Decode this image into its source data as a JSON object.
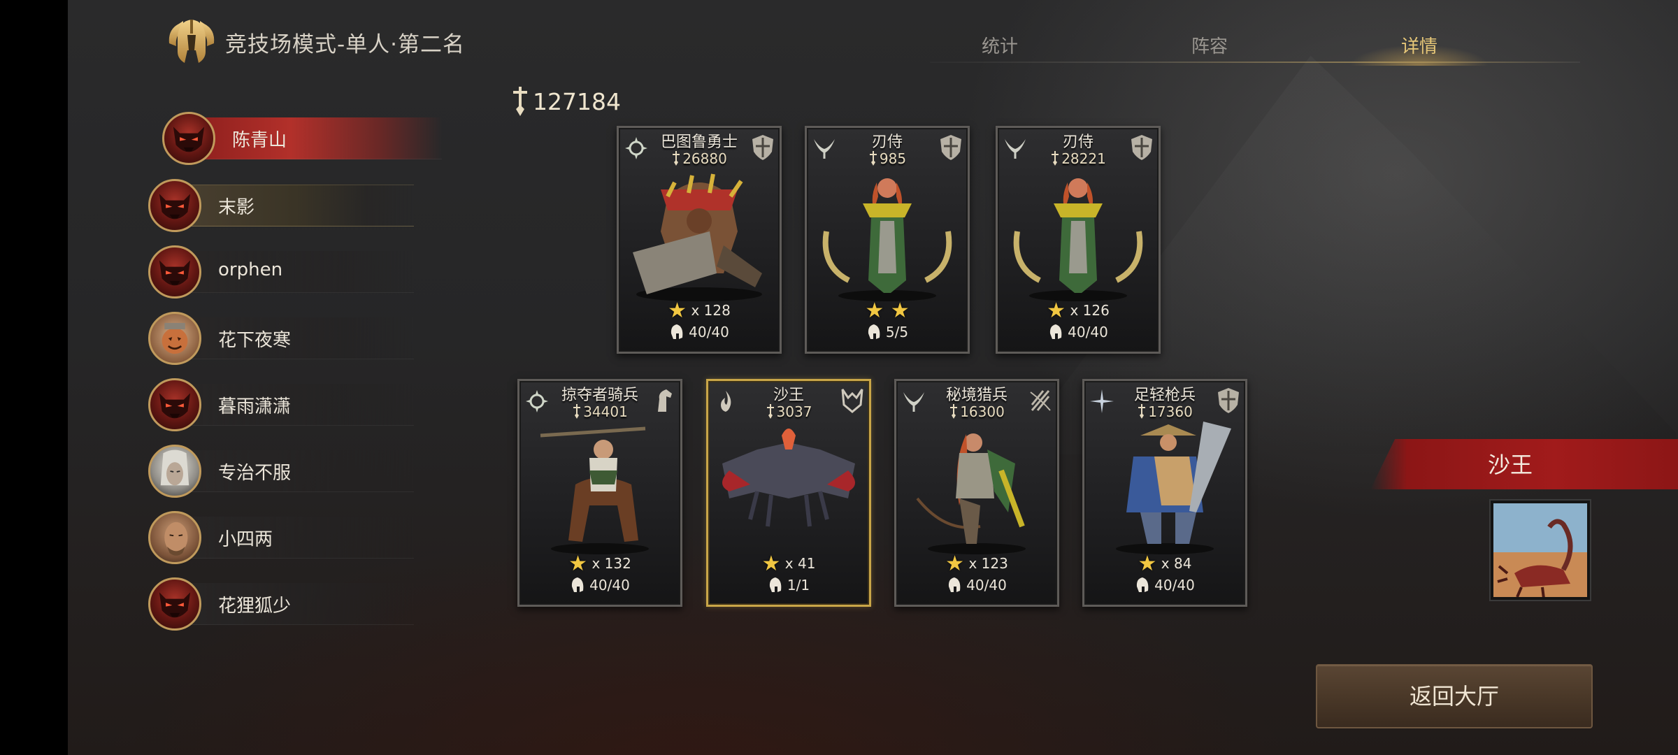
{
  "header": {
    "title": "竞技场模式-单人·第二名",
    "logo_icon": "spartan-helmet-icon"
  },
  "tabs": [
    {
      "label": "统计",
      "active": false
    },
    {
      "label": "阵容",
      "active": false
    },
    {
      "label": "详情",
      "active": true
    }
  ],
  "players": [
    {
      "name": "陈青山",
      "avatar": "demon-mask-avatar",
      "state": "active"
    },
    {
      "name": "末影",
      "avatar": "demon-mask-avatar",
      "state": "highlight"
    },
    {
      "name": "orphen",
      "avatar": "demon-mask-avatar",
      "state": ""
    },
    {
      "name": "花下夜寒",
      "avatar": "pumpkin-warrior-avatar",
      "state": ""
    },
    {
      "name": "暮雨潇潇",
      "avatar": "demon-mask-avatar",
      "state": ""
    },
    {
      "name": "专治不服",
      "avatar": "elf-avatar",
      "state": ""
    },
    {
      "name": "小四两",
      "avatar": "bald-warrior-avatar",
      "state": ""
    },
    {
      "name": "花狸狐少",
      "avatar": "demon-mask-avatar",
      "state": ""
    }
  ],
  "total_power": "127184",
  "power_icon": "sword-power-icon",
  "units_row1": [
    {
      "name": "巴图鲁勇士",
      "power": "26880",
      "stars": "x 128",
      "star_count": 1,
      "count": "40/40",
      "icon_left": "tribal-gear-icon",
      "icon_right": "shield-icon",
      "art": "barbarian-warrior-art"
    },
    {
      "name": "刃侍",
      "power": "985",
      "stars": "",
      "star_count": 2,
      "count": "5/5",
      "icon_left": "crossed-blades-icon",
      "icon_right": "shield-icon",
      "art": "blade-maiden-art"
    },
    {
      "name": "刃侍",
      "power": "28221",
      "stars": "x 126",
      "star_count": 1,
      "count": "40/40",
      "icon_left": "crossed-blades-icon",
      "icon_right": "shield-icon",
      "art": "blade-maiden-art"
    }
  ],
  "units_row2": [
    {
      "name": "掠夺者骑兵",
      "power": "34401",
      "stars": "x 132",
      "star_count": 1,
      "count": "40/40",
      "icon_left": "tribal-gear-icon",
      "icon_right": "horse-head-icon",
      "art": "raider-cavalry-art"
    },
    {
      "name": "沙王",
      "power": "3037",
      "stars": "x 41",
      "star_count": 1,
      "count": "1/1",
      "icon_left": "flame-icon",
      "icon_right": "horned-crest-icon",
      "art": "sand-king-scorpion-art",
      "selected": true
    },
    {
      "name": "秘境猎兵",
      "power": "16300",
      "stars": "x 123",
      "star_count": 1,
      "count": "40/40",
      "icon_left": "crossed-blades-icon",
      "icon_right": "bow-arrows-icon",
      "art": "huntress-archer-art"
    },
    {
      "name": "足轻枪兵",
      "power": "17360",
      "stars": "x 84",
      "star_count": 1,
      "count": "40/40",
      "icon_left": "frost-star-icon",
      "icon_right": "shield-icon",
      "art": "ashigaru-spearman-art"
    }
  ],
  "selected_unit": {
    "name": "沙王",
    "portrait": "sand-king-scorpion-portrait"
  },
  "return_button": "返回大厅",
  "colors": {
    "accent_gold": "#e6c677",
    "active_red": "#b2302a",
    "star_gold": "#f1c742",
    "selected_border": "#c9a648"
  }
}
